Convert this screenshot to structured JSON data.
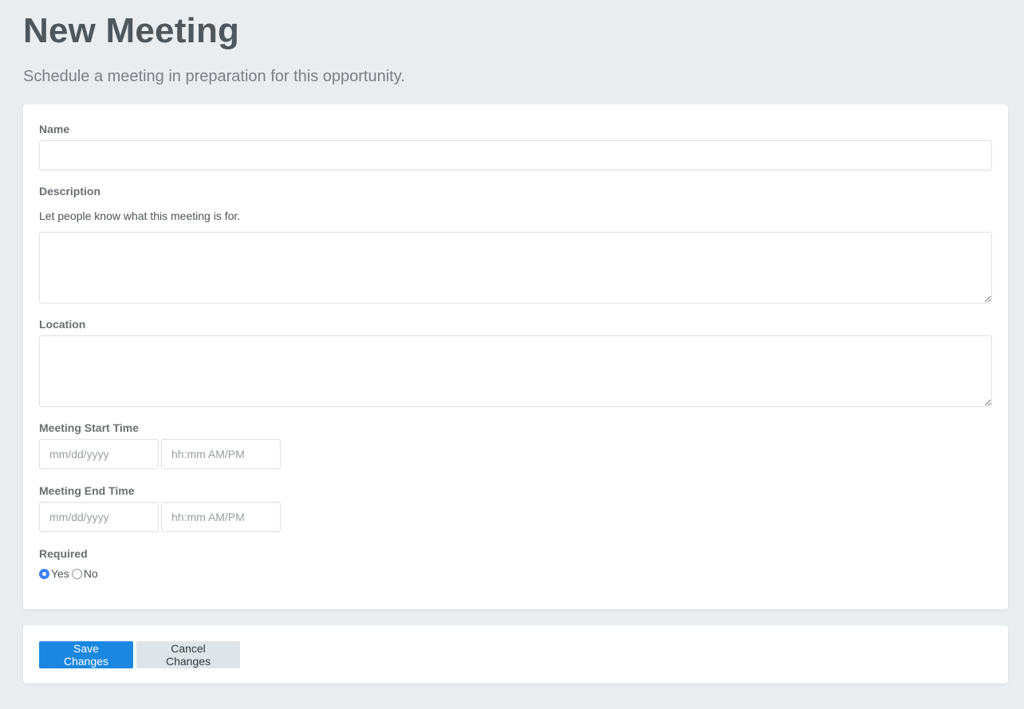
{
  "header": {
    "title": "New Meeting",
    "subtitle": "Schedule a meeting in preparation for this opportunity."
  },
  "form": {
    "name": {
      "label": "Name",
      "value": ""
    },
    "description": {
      "label": "Description",
      "help": "Let people know what this meeting is for.",
      "value": ""
    },
    "location": {
      "label": "Location",
      "value": ""
    },
    "start_time": {
      "label": "Meeting Start Time",
      "date_placeholder": "mm/dd/yyyy",
      "time_placeholder": "hh:mm AM/PM"
    },
    "end_time": {
      "label": "Meeting End Time",
      "date_placeholder": "mm/dd/yyyy",
      "time_placeholder": "hh:mm AM/PM"
    },
    "required": {
      "label": "Required",
      "options": [
        {
          "label": "Yes",
          "selected": true
        },
        {
          "label": "No",
          "selected": false
        }
      ]
    }
  },
  "actions": {
    "save_label": "Save Changes",
    "cancel_label": "Cancel Changes"
  },
  "colors": {
    "primary": "#1a87e0",
    "background": "#e9edf0",
    "radio_checked": "#3b82f6"
  }
}
